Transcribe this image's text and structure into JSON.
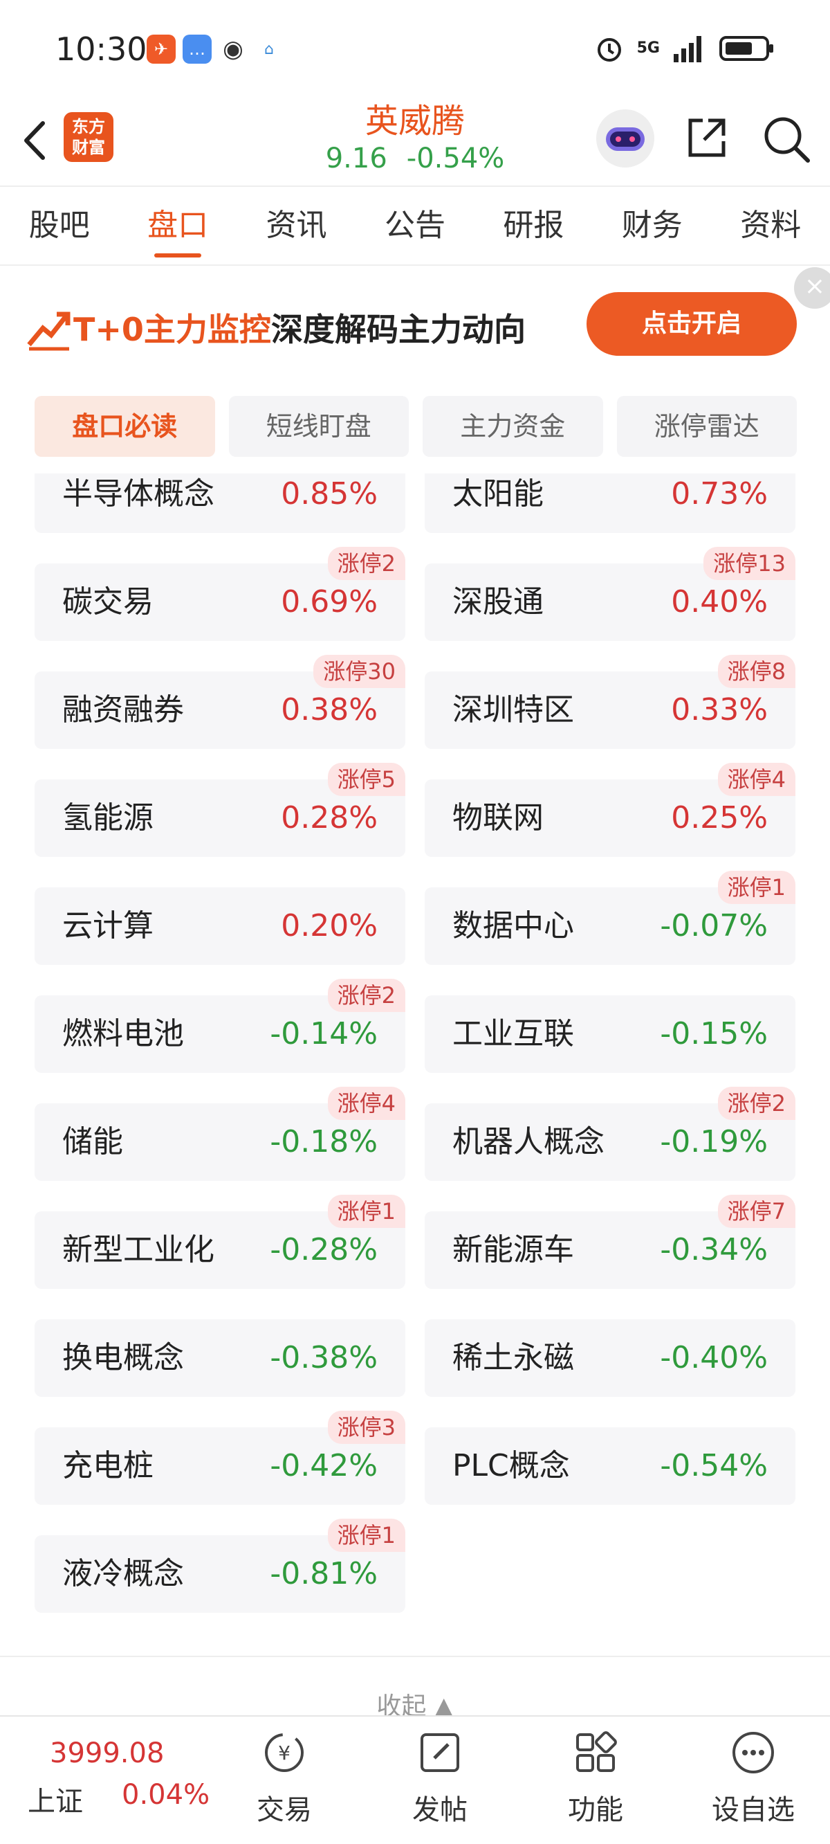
{
  "status_bar": {
    "time": "10:30",
    "network": "5G"
  },
  "header": {
    "logo_text": "东方\n财富",
    "title": "英威腾",
    "price": "9.16",
    "change": "-0.54%"
  },
  "tabs": [
    "股吧",
    "盘口",
    "资讯",
    "公告",
    "研报",
    "财务",
    "资料"
  ],
  "active_tab": 1,
  "banner": {
    "highlight": "T+0主力监控",
    "text": "深度解码主力动向",
    "button": "点击开启"
  },
  "subtabs": [
    "盘口必读",
    "短线盯盘",
    "主力资金",
    "涨停雷达"
  ],
  "active_subtab": 0,
  "concepts": [
    {
      "name": "半导体概念",
      "pct": "0.85%",
      "dir": "up",
      "badge": ""
    },
    {
      "name": "太阳能",
      "pct": "0.73%",
      "dir": "up",
      "badge": ""
    },
    {
      "name": "碳交易",
      "pct": "0.69%",
      "dir": "up",
      "badge": "涨停2"
    },
    {
      "name": "深股通",
      "pct": "0.40%",
      "dir": "up",
      "badge": "涨停13"
    },
    {
      "name": "融资融券",
      "pct": "0.38%",
      "dir": "up",
      "badge": "涨停30"
    },
    {
      "name": "深圳特区",
      "pct": "0.33%",
      "dir": "up",
      "badge": "涨停8"
    },
    {
      "name": "氢能源",
      "pct": "0.28%",
      "dir": "up",
      "badge": "涨停5"
    },
    {
      "name": "物联网",
      "pct": "0.25%",
      "dir": "up",
      "badge": "涨停4"
    },
    {
      "name": "云计算",
      "pct": "0.20%",
      "dir": "up",
      "badge": ""
    },
    {
      "name": "数据中心",
      "pct": "-0.07%",
      "dir": "dn",
      "badge": "涨停1"
    },
    {
      "name": "燃料电池",
      "pct": "-0.14%",
      "dir": "dn",
      "badge": "涨停2"
    },
    {
      "name": "工业互联",
      "pct": "-0.15%",
      "dir": "dn",
      "badge": ""
    },
    {
      "name": "储能",
      "pct": "-0.18%",
      "dir": "dn",
      "badge": "涨停4"
    },
    {
      "name": "机器人概念",
      "pct": "-0.19%",
      "dir": "dn",
      "badge": "涨停2"
    },
    {
      "name": "新型工业化",
      "pct": "-0.28%",
      "dir": "dn",
      "badge": "涨停1"
    },
    {
      "name": "新能源车",
      "pct": "-0.34%",
      "dir": "dn",
      "badge": "涨停7"
    },
    {
      "name": "换电概念",
      "pct": "-0.38%",
      "dir": "dn",
      "badge": ""
    },
    {
      "name": "稀土永磁",
      "pct": "-0.40%",
      "dir": "dn",
      "badge": ""
    },
    {
      "name": "充电桩",
      "pct": "-0.42%",
      "dir": "dn",
      "badge": "涨停3"
    },
    {
      "name": "PLC概念",
      "pct": "-0.54%",
      "dir": "dn",
      "badge": ""
    },
    {
      "name": "液冷概念",
      "pct": "-0.81%",
      "dir": "dn",
      "badge": "涨停1"
    }
  ],
  "collapse": "收起",
  "bottom": {
    "index_value": "3999.08",
    "index_name": "上证",
    "index_change": "0.04%",
    "nav": [
      "交易",
      "发帖",
      "功能",
      "设自选"
    ]
  },
  "colors": {
    "accent": "#e8541e",
    "up": "#d53535",
    "down": "#2f9a3c"
  }
}
